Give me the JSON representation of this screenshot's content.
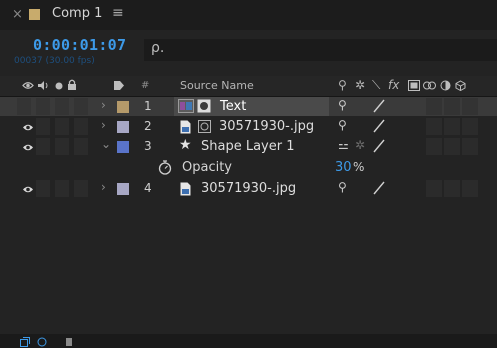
{
  "tab": {
    "close": "×",
    "title": "Comp 1",
    "menu": "≡",
    "swatch_color": "#c8ab6c"
  },
  "timecode": {
    "value": "0:00:01:07",
    "frames": "00037 (30.00 fps)"
  },
  "search": {
    "icon": "ρ.",
    "placeholder": ""
  },
  "header": {
    "hash": "#",
    "source_name": "Source Name",
    "icons": [
      "eye-icon",
      "audio-icon",
      "solo-icon",
      "lock-icon",
      "label-icon"
    ],
    "switch_icons": [
      "shy-icon",
      "collapse-icon",
      "quality-icon",
      "fx-icon",
      "frame-blend-icon",
      "motion-blur-icon",
      "adjustment-icon",
      "3d-icon"
    ]
  },
  "layers": [
    {
      "num": "1",
      "name": "Text",
      "type": "text",
      "label_color": "#b59a6a",
      "selected": true,
      "eye": false
    },
    {
      "num": "2",
      "name": "30571930-.jpg",
      "type": "footage",
      "label_color": "#a7a7c4",
      "selected": false,
      "eye": true
    },
    {
      "num": "3",
      "name": "Shape Layer 1",
      "type": "shape",
      "label_color": "#5a74c9",
      "selected": false,
      "eye": true,
      "expanded": true
    },
    {
      "num": "4",
      "name": "30571930-.jpg",
      "type": "footage",
      "label_color": "#a7a7c4",
      "selected": false,
      "eye": true
    }
  ],
  "property": {
    "name": "Opacity",
    "value": "30",
    "unit": "%",
    "value_color": "#3d9ae8"
  }
}
